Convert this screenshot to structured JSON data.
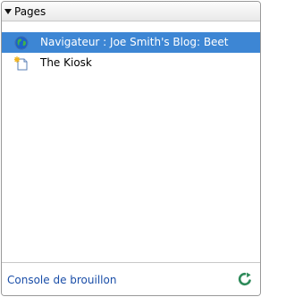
{
  "header": {
    "title": "Pages",
    "toggle_icon": "triangle-down-icon"
  },
  "pages": [
    {
      "label": "Navigateur : Joe Smith's Blog: Beet",
      "icon": "globe-icon",
      "selected": true
    },
    {
      "label": "The Kiosk",
      "icon": "new-page-icon",
      "selected": false
    }
  ],
  "footer": {
    "console_label": "Console de brouillon",
    "refresh_icon": "refresh-icon"
  },
  "colors": {
    "selection": "#3d86d4",
    "link": "#1a4ea8",
    "refresh": "#2e8a5a"
  }
}
